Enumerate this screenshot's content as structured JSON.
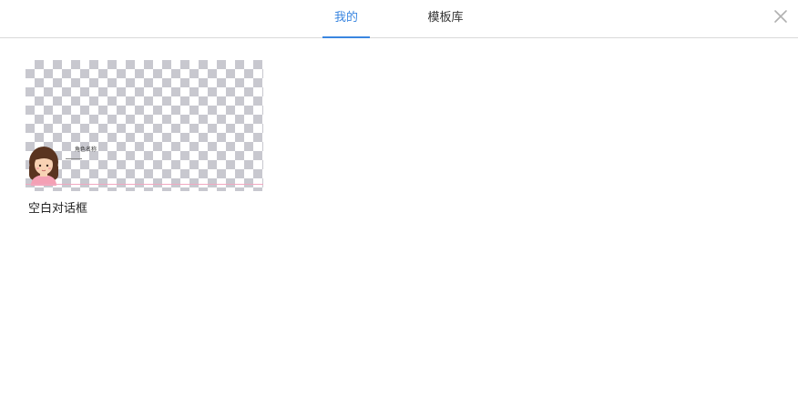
{
  "tabs": [
    {
      "label": "我的",
      "active": true
    },
    {
      "label": "模板库",
      "active": false
    }
  ],
  "close_icon": "close-icon",
  "accent_color": "#3a86e0",
  "templates": [
    {
      "title": "空白对话框",
      "preview_character_name": "角色名称"
    }
  ]
}
